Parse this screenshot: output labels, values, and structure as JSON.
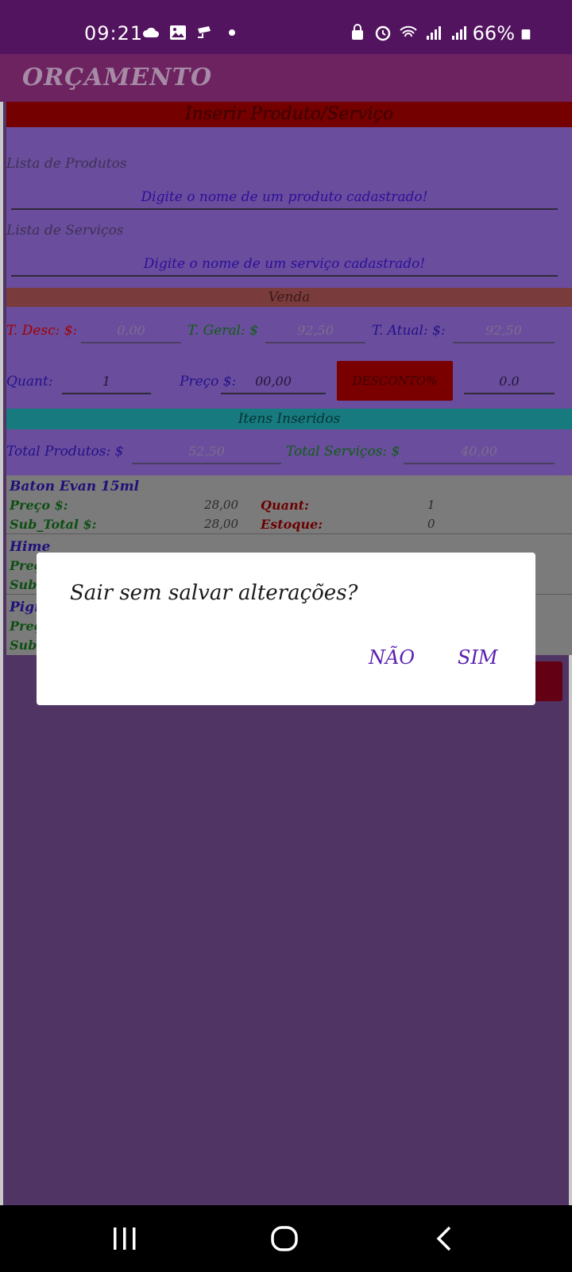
{
  "status_bar": {
    "time": "09:21",
    "battery": "66%",
    "icons_left": [
      "cloud-icon",
      "image-icon",
      "cctv-icon",
      "dot-icon"
    ],
    "icons_right": [
      "lock-icon",
      "alarm-icon",
      "wifi-icon",
      "signal-icon",
      "signal-icon",
      "battery-icon"
    ]
  },
  "app_bar": {
    "title": "ORÇAMENTO"
  },
  "header_bar": "Inserir Produto/Serviço",
  "products": {
    "label": "Lista de Produtos",
    "placeholder": "Digite o nome de um produto cadastrado!"
  },
  "services": {
    "label": "Lista de Serviços",
    "placeholder": "Digite o nome de um serviço cadastrado!"
  },
  "venda_bar": "Venda",
  "totals": {
    "desc_label": "T. Desc: $:",
    "desc_value": "0,00",
    "geral_label": "T. Geral: $",
    "geral_value": "92,50",
    "atual_label": "T. Atual: $:",
    "atual_value": "92,50"
  },
  "entry": {
    "quant_label": "Quant:",
    "quant_value": "1",
    "preco_label": "Preço $:",
    "preco_value": "00,00",
    "desconto_button": "DESCONTO%",
    "desconto_value": "0.0"
  },
  "itens_bar": "Itens Inseridos",
  "summary": {
    "produtos_label": "Total Produtos: $",
    "produtos_value": "52,50",
    "servicos_label": "Total Serviços: $",
    "servicos_value": "40,00"
  },
  "items": [
    {
      "name": "Baton Evan 15ml",
      "preco_label": "Preço $:",
      "preco": "28,00",
      "quant_label": "Quant:",
      "quant": "1",
      "subtotal_label": "Sub_Total $:",
      "subtotal": "28,00",
      "estoque_label": "Estoque:",
      "estoque": "0"
    },
    {
      "name": "Hime",
      "preco_label": "Preç",
      "subtotal_label": "Sub_"
    },
    {
      "name": "Pigm",
      "preco_label": "Preç",
      "subtotal_label": "Sub_"
    }
  ],
  "dialog": {
    "message": "Sair sem salvar alterações?",
    "no_button": "NÃO",
    "yes_button": "SIM"
  },
  "colors": {
    "status_bar": "#52135f",
    "app_bar": "#6d2360",
    "dialog_button": "#5a20b0"
  }
}
